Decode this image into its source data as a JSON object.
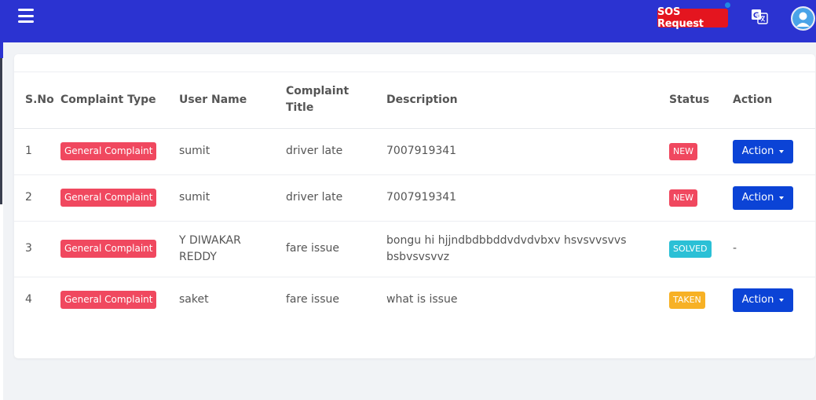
{
  "header": {
    "sos_label": "SOS Request",
    "icons": [
      "hamburger-menu-icon",
      "translate-icon",
      "user-avatar"
    ],
    "colors": {
      "topbar": "#2b33d1",
      "sos": "#e4151f"
    }
  },
  "table": {
    "columns": [
      "S.No",
      "Complaint Type",
      "User Name",
      "Complaint Title",
      "Description",
      "Status",
      "Action"
    ],
    "rows": [
      {
        "sno": "1",
        "type": "General Complaint",
        "user": "sumit",
        "title": "driver late",
        "description": "7007919341",
        "status": "NEW",
        "action": "Action"
      },
      {
        "sno": "2",
        "type": "General Complaint",
        "user": "sumit",
        "title": "driver late",
        "description": "7007919341",
        "status": "NEW",
        "action": "Action"
      },
      {
        "sno": "3",
        "type": "General Complaint",
        "user": "Y DIWAKAR REDDY",
        "title": "fare issue",
        "description": "bongu hi hjjndbdbbddvdvdvbxv hsvsvvsvvs bsbvsvsvvz",
        "status": "SOLVED",
        "action": "-"
      },
      {
        "sno": "4",
        "type": "General Complaint",
        "user": "saket",
        "title": "fare issue",
        "description": "what is issue",
        "status": "TAKEN",
        "action": "Action"
      }
    ],
    "status_colors": {
      "NEW": "#f0485f",
      "SOLVED": "#2bc0d6",
      "TAKEN": "#f7b125"
    }
  }
}
